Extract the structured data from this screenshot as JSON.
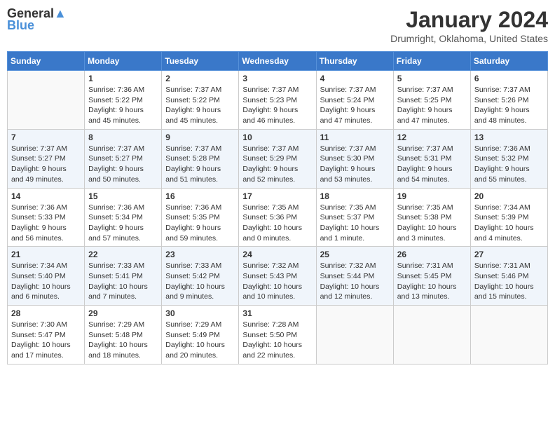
{
  "header": {
    "logo_line1": "General",
    "logo_line2": "Blue",
    "month_title": "January 2024",
    "location": "Drumright, Oklahoma, United States"
  },
  "weekdays": [
    "Sunday",
    "Monday",
    "Tuesday",
    "Wednesday",
    "Thursday",
    "Friday",
    "Saturday"
  ],
  "weeks": [
    [
      {
        "day": "",
        "sunrise": "",
        "sunset": "",
        "daylight": ""
      },
      {
        "day": "1",
        "sunrise": "Sunrise: 7:36 AM",
        "sunset": "Sunset: 5:22 PM",
        "daylight": "Daylight: 9 hours and 45 minutes."
      },
      {
        "day": "2",
        "sunrise": "Sunrise: 7:37 AM",
        "sunset": "Sunset: 5:22 PM",
        "daylight": "Daylight: 9 hours and 45 minutes."
      },
      {
        "day": "3",
        "sunrise": "Sunrise: 7:37 AM",
        "sunset": "Sunset: 5:23 PM",
        "daylight": "Daylight: 9 hours and 46 minutes."
      },
      {
        "day": "4",
        "sunrise": "Sunrise: 7:37 AM",
        "sunset": "Sunset: 5:24 PM",
        "daylight": "Daylight: 9 hours and 47 minutes."
      },
      {
        "day": "5",
        "sunrise": "Sunrise: 7:37 AM",
        "sunset": "Sunset: 5:25 PM",
        "daylight": "Daylight: 9 hours and 47 minutes."
      },
      {
        "day": "6",
        "sunrise": "Sunrise: 7:37 AM",
        "sunset": "Sunset: 5:26 PM",
        "daylight": "Daylight: 9 hours and 48 minutes."
      }
    ],
    [
      {
        "day": "7",
        "sunrise": "Sunrise: 7:37 AM",
        "sunset": "Sunset: 5:27 PM",
        "daylight": "Daylight: 9 hours and 49 minutes."
      },
      {
        "day": "8",
        "sunrise": "Sunrise: 7:37 AM",
        "sunset": "Sunset: 5:27 PM",
        "daylight": "Daylight: 9 hours and 50 minutes."
      },
      {
        "day": "9",
        "sunrise": "Sunrise: 7:37 AM",
        "sunset": "Sunset: 5:28 PM",
        "daylight": "Daylight: 9 hours and 51 minutes."
      },
      {
        "day": "10",
        "sunrise": "Sunrise: 7:37 AM",
        "sunset": "Sunset: 5:29 PM",
        "daylight": "Daylight: 9 hours and 52 minutes."
      },
      {
        "day": "11",
        "sunrise": "Sunrise: 7:37 AM",
        "sunset": "Sunset: 5:30 PM",
        "daylight": "Daylight: 9 hours and 53 minutes."
      },
      {
        "day": "12",
        "sunrise": "Sunrise: 7:37 AM",
        "sunset": "Sunset: 5:31 PM",
        "daylight": "Daylight: 9 hours and 54 minutes."
      },
      {
        "day": "13",
        "sunrise": "Sunrise: 7:36 AM",
        "sunset": "Sunset: 5:32 PM",
        "daylight": "Daylight: 9 hours and 55 minutes."
      }
    ],
    [
      {
        "day": "14",
        "sunrise": "Sunrise: 7:36 AM",
        "sunset": "Sunset: 5:33 PM",
        "daylight": "Daylight: 9 hours and 56 minutes."
      },
      {
        "day": "15",
        "sunrise": "Sunrise: 7:36 AM",
        "sunset": "Sunset: 5:34 PM",
        "daylight": "Daylight: 9 hours and 57 minutes."
      },
      {
        "day": "16",
        "sunrise": "Sunrise: 7:36 AM",
        "sunset": "Sunset: 5:35 PM",
        "daylight": "Daylight: 9 hours and 59 minutes."
      },
      {
        "day": "17",
        "sunrise": "Sunrise: 7:35 AM",
        "sunset": "Sunset: 5:36 PM",
        "daylight": "Daylight: 10 hours and 0 minutes."
      },
      {
        "day": "18",
        "sunrise": "Sunrise: 7:35 AM",
        "sunset": "Sunset: 5:37 PM",
        "daylight": "Daylight: 10 hours and 1 minute."
      },
      {
        "day": "19",
        "sunrise": "Sunrise: 7:35 AM",
        "sunset": "Sunset: 5:38 PM",
        "daylight": "Daylight: 10 hours and 3 minutes."
      },
      {
        "day": "20",
        "sunrise": "Sunrise: 7:34 AM",
        "sunset": "Sunset: 5:39 PM",
        "daylight": "Daylight: 10 hours and 4 minutes."
      }
    ],
    [
      {
        "day": "21",
        "sunrise": "Sunrise: 7:34 AM",
        "sunset": "Sunset: 5:40 PM",
        "daylight": "Daylight: 10 hours and 6 minutes."
      },
      {
        "day": "22",
        "sunrise": "Sunrise: 7:33 AM",
        "sunset": "Sunset: 5:41 PM",
        "daylight": "Daylight: 10 hours and 7 minutes."
      },
      {
        "day": "23",
        "sunrise": "Sunrise: 7:33 AM",
        "sunset": "Sunset: 5:42 PM",
        "daylight": "Daylight: 10 hours and 9 minutes."
      },
      {
        "day": "24",
        "sunrise": "Sunrise: 7:32 AM",
        "sunset": "Sunset: 5:43 PM",
        "daylight": "Daylight: 10 hours and 10 minutes."
      },
      {
        "day": "25",
        "sunrise": "Sunrise: 7:32 AM",
        "sunset": "Sunset: 5:44 PM",
        "daylight": "Daylight: 10 hours and 12 minutes."
      },
      {
        "day": "26",
        "sunrise": "Sunrise: 7:31 AM",
        "sunset": "Sunset: 5:45 PM",
        "daylight": "Daylight: 10 hours and 13 minutes."
      },
      {
        "day": "27",
        "sunrise": "Sunrise: 7:31 AM",
        "sunset": "Sunset: 5:46 PM",
        "daylight": "Daylight: 10 hours and 15 minutes."
      }
    ],
    [
      {
        "day": "28",
        "sunrise": "Sunrise: 7:30 AM",
        "sunset": "Sunset: 5:47 PM",
        "daylight": "Daylight: 10 hours and 17 minutes."
      },
      {
        "day": "29",
        "sunrise": "Sunrise: 7:29 AM",
        "sunset": "Sunset: 5:48 PM",
        "daylight": "Daylight: 10 hours and 18 minutes."
      },
      {
        "day": "30",
        "sunrise": "Sunrise: 7:29 AM",
        "sunset": "Sunset: 5:49 PM",
        "daylight": "Daylight: 10 hours and 20 minutes."
      },
      {
        "day": "31",
        "sunrise": "Sunrise: 7:28 AM",
        "sunset": "Sunset: 5:50 PM",
        "daylight": "Daylight: 10 hours and 22 minutes."
      },
      {
        "day": "",
        "sunrise": "",
        "sunset": "",
        "daylight": ""
      },
      {
        "day": "",
        "sunrise": "",
        "sunset": "",
        "daylight": ""
      },
      {
        "day": "",
        "sunrise": "",
        "sunset": "",
        "daylight": ""
      }
    ]
  ]
}
